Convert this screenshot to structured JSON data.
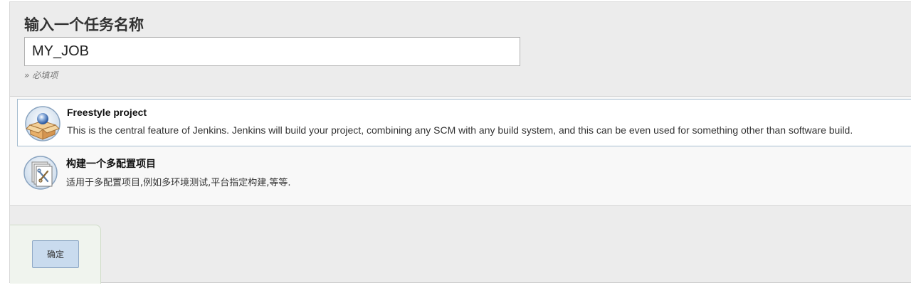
{
  "form": {
    "title": "输入一个任务名称",
    "name_value": "MY_JOB",
    "required_hint": "» 必填项"
  },
  "job_types": [
    {
      "title": "Freestyle project",
      "description": "This is the central feature of Jenkins. Jenkins will build your project, combining any SCM with any build system, and this can be even used for something other than software build.",
      "icon": "freestyle-project-icon",
      "selected": true
    },
    {
      "title": "构建一个多配置项目",
      "description": "适用于多配置项目,例如多环境测试,平台指定构建,等等.",
      "icon": "multi-config-project-icon",
      "selected": false
    }
  ],
  "actions": {
    "ok_label": "确定"
  },
  "colors": {
    "page_background": "#ececec",
    "selected_border": "#a6bdd0",
    "button_background": "#c9dbee"
  }
}
